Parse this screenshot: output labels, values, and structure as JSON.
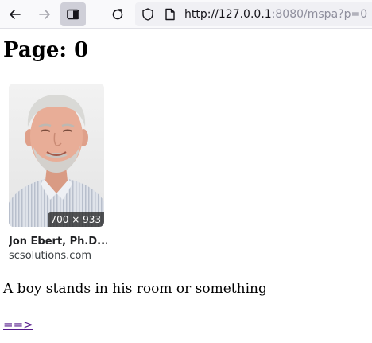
{
  "browser": {
    "url_host": "http://127.0.0.1",
    "url_rest": ":8080/mspa?p=0"
  },
  "page": {
    "title": "Page: 0",
    "result": {
      "dimensions": "700 × 933",
      "title": "Jon Ebert, Ph.D....",
      "source": "scsolutions.com"
    },
    "caption": "A boy stands in his room or something",
    "next_link": "==>"
  }
}
